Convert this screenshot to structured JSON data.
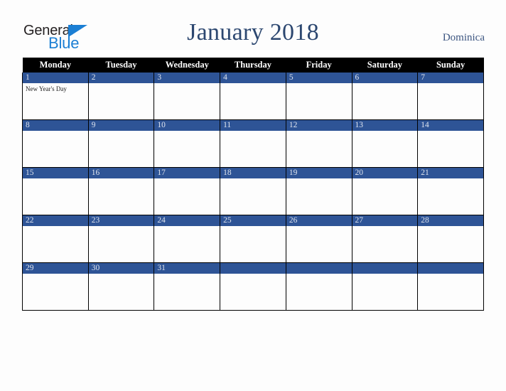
{
  "logo": {
    "word_dark": "General",
    "word_blue": "Blue",
    "triangle_color": "#1b7fd4"
  },
  "header": {
    "title": "January 2018",
    "country": "Dominica"
  },
  "colors": {
    "day_bar": "#2e5496",
    "header_bar": "#000000",
    "title_text": "#2c4770",
    "country_text": "#3c5580",
    "page_background": "#fdfdfd"
  },
  "calendar": {
    "weekday_headers": [
      "Monday",
      "Tuesday",
      "Wednesday",
      "Thursday",
      "Friday",
      "Saturday",
      "Sunday"
    ],
    "weeks": [
      [
        {
          "day": "1",
          "events": [
            "New Year's Day"
          ]
        },
        {
          "day": "2",
          "events": []
        },
        {
          "day": "3",
          "events": []
        },
        {
          "day": "4",
          "events": []
        },
        {
          "day": "5",
          "events": []
        },
        {
          "day": "6",
          "events": []
        },
        {
          "day": "7",
          "events": []
        }
      ],
      [
        {
          "day": "8",
          "events": []
        },
        {
          "day": "9",
          "events": []
        },
        {
          "day": "10",
          "events": []
        },
        {
          "day": "11",
          "events": []
        },
        {
          "day": "12",
          "events": []
        },
        {
          "day": "13",
          "events": []
        },
        {
          "day": "14",
          "events": []
        }
      ],
      [
        {
          "day": "15",
          "events": []
        },
        {
          "day": "16",
          "events": []
        },
        {
          "day": "17",
          "events": []
        },
        {
          "day": "18",
          "events": []
        },
        {
          "day": "19",
          "events": []
        },
        {
          "day": "20",
          "events": []
        },
        {
          "day": "21",
          "events": []
        }
      ],
      [
        {
          "day": "22",
          "events": []
        },
        {
          "day": "23",
          "events": []
        },
        {
          "day": "24",
          "events": []
        },
        {
          "day": "25",
          "events": []
        },
        {
          "day": "26",
          "events": []
        },
        {
          "day": "27",
          "events": []
        },
        {
          "day": "28",
          "events": []
        }
      ],
      [
        {
          "day": "29",
          "events": []
        },
        {
          "day": "30",
          "events": []
        },
        {
          "day": "31",
          "events": []
        },
        {
          "day": "",
          "events": []
        },
        {
          "day": "",
          "events": []
        },
        {
          "day": "",
          "events": []
        },
        {
          "day": "",
          "events": []
        }
      ]
    ]
  }
}
